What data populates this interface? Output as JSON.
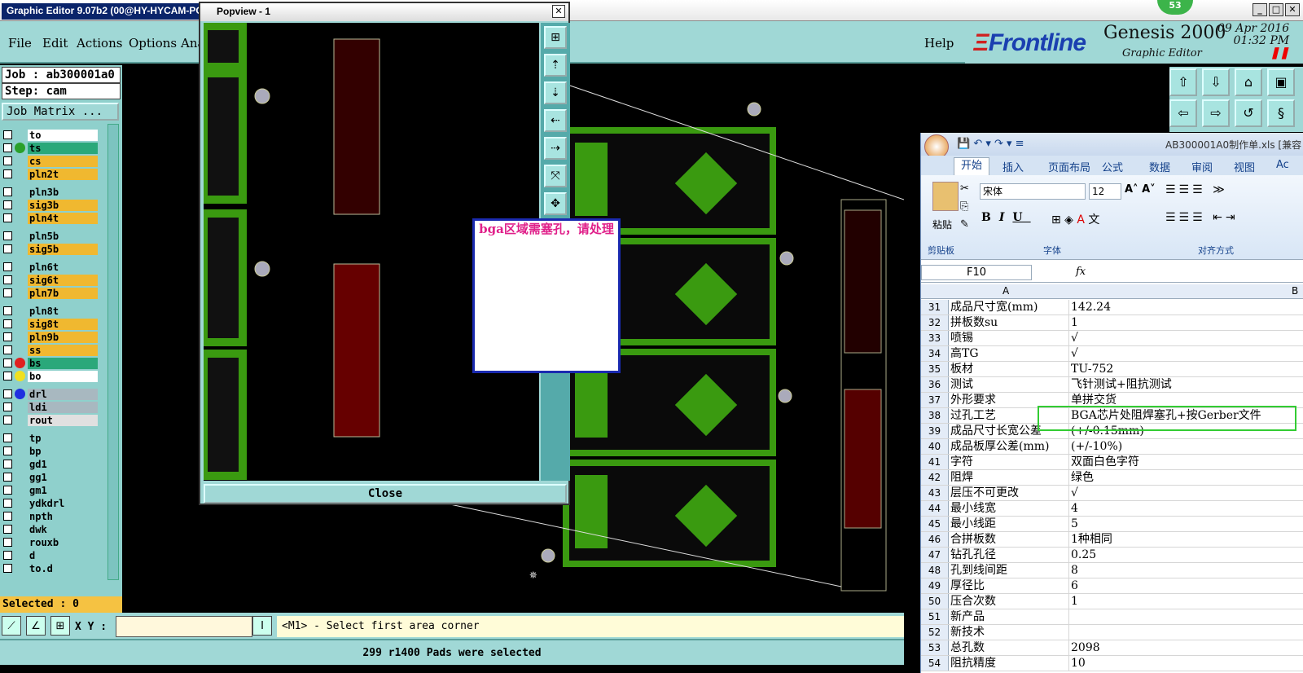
{
  "app": {
    "title": "Graphic Editor 9.07b2 (00@HY-HYCAM-PC",
    "badge": "53"
  },
  "menu": {
    "file": "File",
    "edit": "Edit",
    "actions": "Actions",
    "options": "Options",
    "analysis": "Ana",
    "help": "Help"
  },
  "brand": {
    "frontline": "Frontline",
    "genesis": "Genesis 2000",
    "ge": "Graphic Editor",
    "date": "09 Apr 2016",
    "time": "01:32 PM"
  },
  "job": {
    "job": "Job : ab300001a0",
    "step": "Step: cam",
    "matrix": "Job Matrix ..."
  },
  "layers": [
    {
      "name": "to",
      "color": "#ffffff",
      "dot": ""
    },
    {
      "name": "ts",
      "color": "#2aa87a",
      "dot": "#2aa02a"
    },
    {
      "name": "cs",
      "color": "#f0b830",
      "dot": ""
    },
    {
      "name": "pln2t",
      "color": "#f0b830",
      "dot": ""
    },
    {
      "name": "pln3b",
      "color": "#8fd0cc",
      "dot": ""
    },
    {
      "name": "sig3b",
      "color": "#f0b830",
      "dot": ""
    },
    {
      "name": "pln4t",
      "color": "#f0b830",
      "dot": ""
    },
    {
      "name": "pln5b",
      "color": "#8fd0cc",
      "dot": ""
    },
    {
      "name": "sig5b",
      "color": "#f0b830",
      "dot": ""
    },
    {
      "name": "pln6t",
      "color": "#8fd0cc",
      "dot": ""
    },
    {
      "name": "sig6t",
      "color": "#f0b830",
      "dot": ""
    },
    {
      "name": "pln7b",
      "color": "#f0b830",
      "dot": ""
    },
    {
      "name": "pln8t",
      "color": "#8fd0cc",
      "dot": ""
    },
    {
      "name": "sig8t",
      "color": "#f0b830",
      "dot": ""
    },
    {
      "name": "pln9b",
      "color": "#f0b830",
      "dot": ""
    },
    {
      "name": "ss",
      "color": "#f0b830",
      "dot": ""
    },
    {
      "name": "bs",
      "color": "#2aa87a",
      "dot": "#e02020"
    },
    {
      "name": "bo",
      "color": "#ffffff",
      "dot": "#f0e020"
    },
    {
      "name": "drl",
      "color": "#a8b8c0",
      "dot": "#2030e0"
    },
    {
      "name": "ldi",
      "color": "#a8b8c0",
      "dot": ""
    },
    {
      "name": "rout",
      "color": "#e0e0e0",
      "dot": ""
    },
    {
      "name": "tp",
      "color": "#8fd0cc",
      "dot": ""
    },
    {
      "name": "bp",
      "color": "#8fd0cc",
      "dot": ""
    },
    {
      "name": "gd1",
      "color": "#8fd0cc",
      "dot": ""
    },
    {
      "name": "gg1",
      "color": "#8fd0cc",
      "dot": ""
    },
    {
      "name": "gm1",
      "color": "#8fd0cc",
      "dot": ""
    },
    {
      "name": "ydkdrl",
      "color": "#8fd0cc",
      "dot": ""
    },
    {
      "name": "npth",
      "color": "#8fd0cc",
      "dot": ""
    },
    {
      "name": "dwk",
      "color": "#8fd0cc",
      "dot": ""
    },
    {
      "name": "rouxb",
      "color": "#8fd0cc",
      "dot": ""
    },
    {
      "name": "d",
      "color": "#8fd0cc",
      "dot": ""
    },
    {
      "name": "to.d",
      "color": "#8fd0cc",
      "dot": ""
    }
  ],
  "selected": "Selected : 0",
  "xy_label": "X Y :",
  "prompt": "<M1> - Select first area corner",
  "status": "299 r1400 Pads were selected",
  "popview": {
    "title": "Popview - 1",
    "close": "Close"
  },
  "note": {
    "text": "bga区域需塞孔，请处理"
  },
  "excel": {
    "title": "AB300001A0制作单.xls [兼容",
    "tabs": [
      "开始",
      "插入",
      "页面布局",
      "公式",
      "数据",
      "审阅",
      "视图",
      "Ac"
    ],
    "paste": "粘贴",
    "clipboard": "剪贴板",
    "font_group": "字体",
    "align_group": "对齐方式",
    "font_name": "宋体",
    "font_size": "12",
    "cell_ref": "F10",
    "fx": "fx",
    "col_a": "A",
    "col_b": "B",
    "rows": [
      {
        "n": "31",
        "a": "成品尺寸宽(mm)",
        "b": "142.24"
      },
      {
        "n": "32",
        "a": "拼板数su",
        "b": "1"
      },
      {
        "n": "33",
        "a": "喷锡",
        "b": "√"
      },
      {
        "n": "34",
        "a": "高TG",
        "b": "√"
      },
      {
        "n": "35",
        "a": "板材",
        "b": "TU-752"
      },
      {
        "n": "36",
        "a": "测试",
        "b": "飞针测试+阻抗测试"
      },
      {
        "n": "37",
        "a": "外形要求",
        "b": "单拼交货"
      },
      {
        "n": "38",
        "a": "过孔工艺",
        "b": "BGA芯片处阻焊塞孔+按Gerber文件"
      },
      {
        "n": "39",
        "a": "成品尺寸长宽公差",
        "b": "(+/-0.15mm)"
      },
      {
        "n": "40",
        "a": "成品板厚公差(mm)",
        "b": "(+/-10%)"
      },
      {
        "n": "41",
        "a": "字符",
        "b": "双面白色字符"
      },
      {
        "n": "42",
        "a": "阻焊",
        "b": "绿色"
      },
      {
        "n": "43",
        "a": "层压不可更改",
        "b": "√"
      },
      {
        "n": "44",
        "a": "最小线宽",
        "b": "4"
      },
      {
        "n": "45",
        "a": "最小线距",
        "b": "5"
      },
      {
        "n": "46",
        "a": "合拼板数",
        "b": "1种相同"
      },
      {
        "n": "47",
        "a": "钻孔孔径",
        "b": "0.25"
      },
      {
        "n": "48",
        "a": "孔到线间距",
        "b": "8"
      },
      {
        "n": "49",
        "a": "厚径比",
        "b": "6"
      },
      {
        "n": "50",
        "a": "压合次数",
        "b": "1"
      },
      {
        "n": "51",
        "a": "新产品",
        "b": ""
      },
      {
        "n": "52",
        "a": "新技术",
        "b": ""
      },
      {
        "n": "53",
        "a": "总孔数",
        "b": "2098"
      },
      {
        "n": "54",
        "a": "阻抗精度",
        "b": "10"
      }
    ]
  },
  "colors": {
    "teal": "#a0d8d6",
    "pcb_green": "#3a9a10",
    "highlight": "#33cc33"
  }
}
